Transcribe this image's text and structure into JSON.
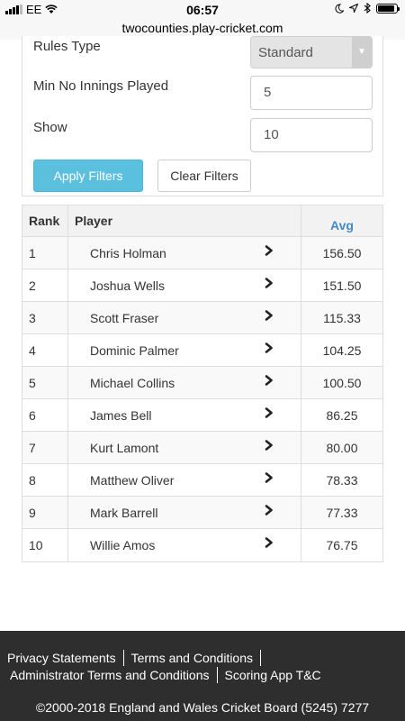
{
  "status_bar": {
    "carrier": "EE",
    "time": "06:57"
  },
  "browser": {
    "url": "twocounties.play-cricket.com"
  },
  "filters": {
    "rules_type_label": "Rules Type",
    "rules_type_value": "Standard",
    "min_innings_label": "Min No Innings Played",
    "min_innings_value": "5",
    "show_label": "Show",
    "show_value": "10",
    "apply_label": "Apply Filters",
    "clear_label": "Clear Filters"
  },
  "table": {
    "headers": {
      "rank": "Rank",
      "player": "Player",
      "avg": "Avg"
    },
    "rows": [
      {
        "rank": "1",
        "player": "Chris Holman",
        "avg": "156.50"
      },
      {
        "rank": "2",
        "player": "Joshua Wells",
        "avg": "151.50"
      },
      {
        "rank": "3",
        "player": "Scott Fraser",
        "avg": "115.33"
      },
      {
        "rank": "4",
        "player": "Dominic Palmer",
        "avg": "104.25"
      },
      {
        "rank": "5",
        "player": "Michael Collins",
        "avg": "100.50"
      },
      {
        "rank": "6",
        "player": "James Bell",
        "avg": "86.25"
      },
      {
        "rank": "7",
        "player": "Kurt Lamont",
        "avg": "80.00"
      },
      {
        "rank": "8",
        "player": "Matthew Oliver",
        "avg": "78.33"
      },
      {
        "rank": "9",
        "player": "Mark Barrell",
        "avg": "77.33"
      },
      {
        "rank": "10",
        "player": "Willie Amos",
        "avg": "76.75"
      }
    ]
  },
  "footer": {
    "privacy": "Privacy Statements",
    "terms": "Terms and Conditions",
    "admin_terms": "Administrator Terms and Conditions",
    "scoring_terms": "Scoring App T&C",
    "copyright": "©2000-2018 England and Wales Cricket Board (5245) 7277"
  },
  "colors": {
    "apply_button": "#5bc0de",
    "avg_header": "#428bca",
    "footer_bg": "#2e2e2e"
  },
  "icons": {
    "signal": "signal-icon",
    "wifi": "wifi-icon",
    "moon": "moon-icon",
    "location": "location-icon",
    "bluetooth": "bluetooth-icon",
    "battery": "battery-icon",
    "row_chevron": "chevron-right-icon",
    "select_arrow": "chevron-down-icon"
  }
}
